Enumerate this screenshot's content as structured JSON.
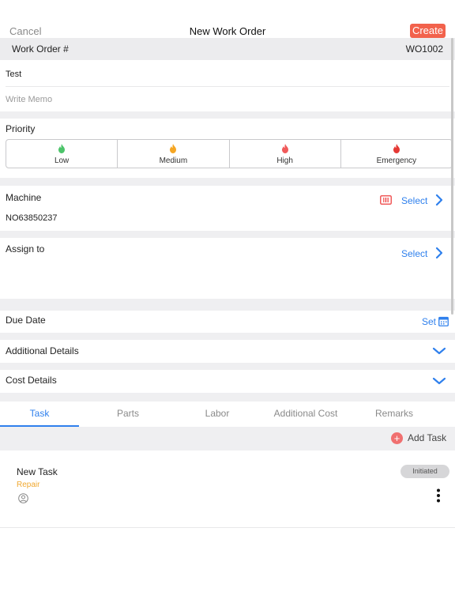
{
  "nav": {
    "cancel": "Cancel",
    "title": "New Work Order",
    "create": "Create"
  },
  "work_order": {
    "label": "Work Order #",
    "number": "WO1002"
  },
  "form": {
    "title_value": "Test",
    "memo_placeholder": "Write Memo"
  },
  "priority": {
    "title": "Priority",
    "options": [
      {
        "label": "Low",
        "color": "#4cc46a"
      },
      {
        "label": "Medium",
        "color": "#f5a623"
      },
      {
        "label": "High",
        "color": "#f05a5a"
      },
      {
        "label": "Emergency",
        "color": "#e53935"
      }
    ]
  },
  "machine": {
    "title": "Machine",
    "select": "Select",
    "value": "NO63850237"
  },
  "assign": {
    "title": "Assign to",
    "select": "Select"
  },
  "due_date": {
    "title": "Due Date",
    "set": "Set"
  },
  "additional_details": {
    "title": "Additional Details"
  },
  "cost_details": {
    "title": "Cost Details"
  },
  "tabs": [
    "Task",
    "Parts",
    "Labor",
    "Additional Cost",
    "Remarks"
  ],
  "add_task": "Add Task",
  "task": {
    "title": "New Task",
    "type": "Repair",
    "status": "Initiated"
  },
  "colors": {
    "accent": "#2f80ed",
    "create": "#f2624c",
    "repair": "#f0a830"
  }
}
